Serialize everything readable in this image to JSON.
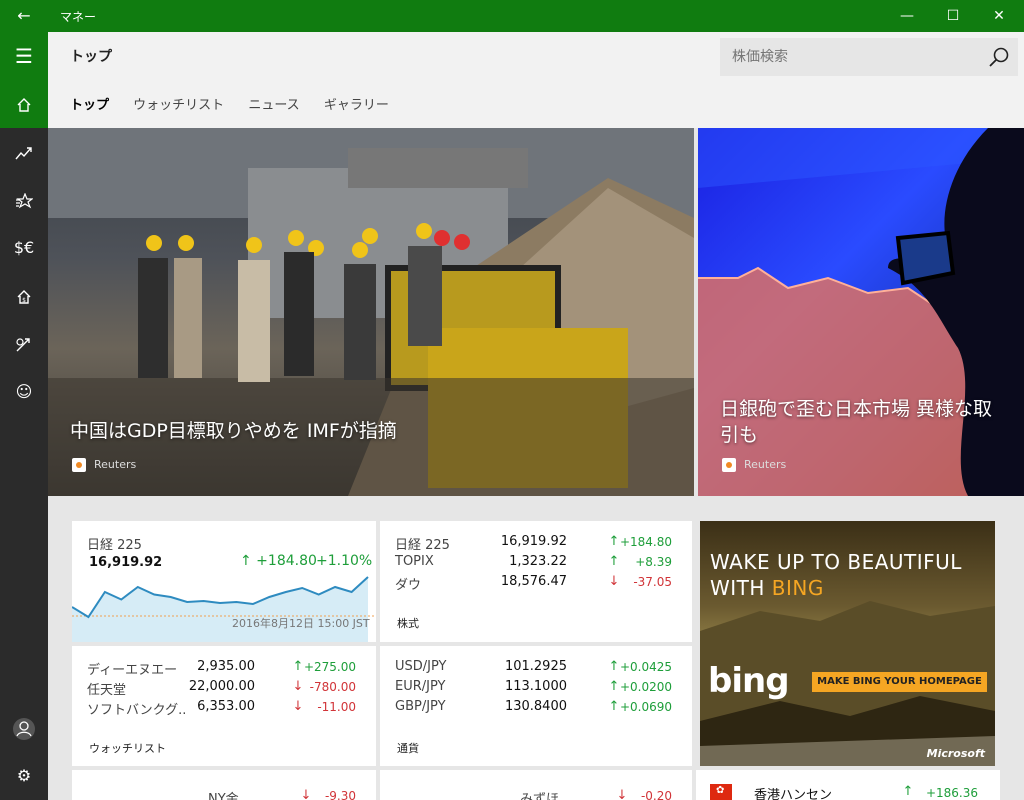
{
  "window": {
    "title": "マネー",
    "back_icon": "back-arrow-icon",
    "minimize": "—",
    "maximize": "☐",
    "close": "✕"
  },
  "header": {
    "page_title": "トップ",
    "search_placeholder": "株価検索",
    "tabs": [
      {
        "label": "トップ",
        "active": true
      },
      {
        "label": "ウォッチリスト",
        "active": false
      },
      {
        "label": "ニュース",
        "active": false
      },
      {
        "label": "ギャラリー",
        "active": false
      }
    ]
  },
  "sidebar": {
    "items": [
      {
        "icon": "home-icon",
        "active": true
      },
      {
        "icon": "trending-chart-icon",
        "active": false
      },
      {
        "icon": "watchlist-star-icon",
        "active": false
      },
      {
        "icon": "currency-icon",
        "active": false
      },
      {
        "icon": "mortgage-house-icon",
        "active": false
      },
      {
        "icon": "calculator-icon",
        "active": false
      },
      {
        "icon": "smiley-feedback-icon",
        "active": false
      }
    ],
    "bottom": [
      {
        "icon": "account-icon"
      },
      {
        "icon": "settings-gear-icon"
      }
    ]
  },
  "heroes": [
    {
      "headline": "中国はGDP目標取りやめを IMFが指摘",
      "source": "Reuters"
    },
    {
      "headline": "日銀砲で歪む日本市場 異様な取引も",
      "source": "Reuters"
    }
  ],
  "index_card": {
    "name": "日経 225",
    "value": "16,919.92",
    "change": "↑ +184.80",
    "percent": "+1.10%",
    "timestamp": "2016年8月12日 15:00 JST",
    "sparkline": [
      16760,
      16740,
      16790,
      16775,
      16800,
      16785,
      16780,
      16770,
      16772,
      16768,
      16770,
      16766,
      16780,
      16790,
      16798,
      16785,
      16800,
      16790,
      16820
    ]
  },
  "stocks_card": {
    "footer": "株式",
    "rows": [
      {
        "name": "日経 225",
        "value": "16,919.92",
        "dir": "up",
        "change": "+184.80"
      },
      {
        "name": "TOPIX",
        "value": "1,323.22",
        "dir": "up",
        "change": "+8.39"
      },
      {
        "name": "ダウ",
        "value": "18,576.47",
        "dir": "down",
        "change": "-37.05"
      }
    ]
  },
  "watchlist_card": {
    "footer": "ウォッチリスト",
    "rows": [
      {
        "name": "ディーエヌエー",
        "value": "2,935.00",
        "dir": "up",
        "change": "+275.00"
      },
      {
        "name": "任天堂",
        "value": "22,000.00",
        "dir": "down",
        "change": "-780.00"
      },
      {
        "name": "ソフトバンクグ...",
        "value": "6,353.00",
        "dir": "down",
        "change": "-11.00"
      }
    ]
  },
  "currency_card": {
    "footer": "通貨",
    "rows": [
      {
        "name": "USD/JPY",
        "value": "101.2925",
        "dir": "up",
        "change": "+0.0425"
      },
      {
        "name": "EUR/JPY",
        "value": "113.1000",
        "dir": "up",
        "change": "+0.0200"
      },
      {
        "name": "GBP/JPY",
        "value": "130.8400",
        "dir": "up",
        "change": "+0.0690"
      }
    ]
  },
  "partial_cards": [
    {
      "name": "NY金",
      "dir": "down",
      "change": "-9.30"
    },
    {
      "name": "みずほ",
      "dir": "down",
      "change": "-0.20"
    },
    {
      "name": "香港ハンセン",
      "dir": "up",
      "change": "+186.36"
    }
  ],
  "ad": {
    "line1": "WAKE UP TO BEAUTIFUL",
    "line2_prefix": "WITH ",
    "line2_brand": "BING",
    "brand_logo": "bing",
    "button": "MAKE BING YOUR HOMEPAGE",
    "sponsor": "Microsoft"
  },
  "colors": {
    "accent": "#107c10",
    "sidebar": "#2b2b2b",
    "up": "#1e9e3a",
    "down": "#d13438",
    "sparkline": "#2e8bc0"
  }
}
